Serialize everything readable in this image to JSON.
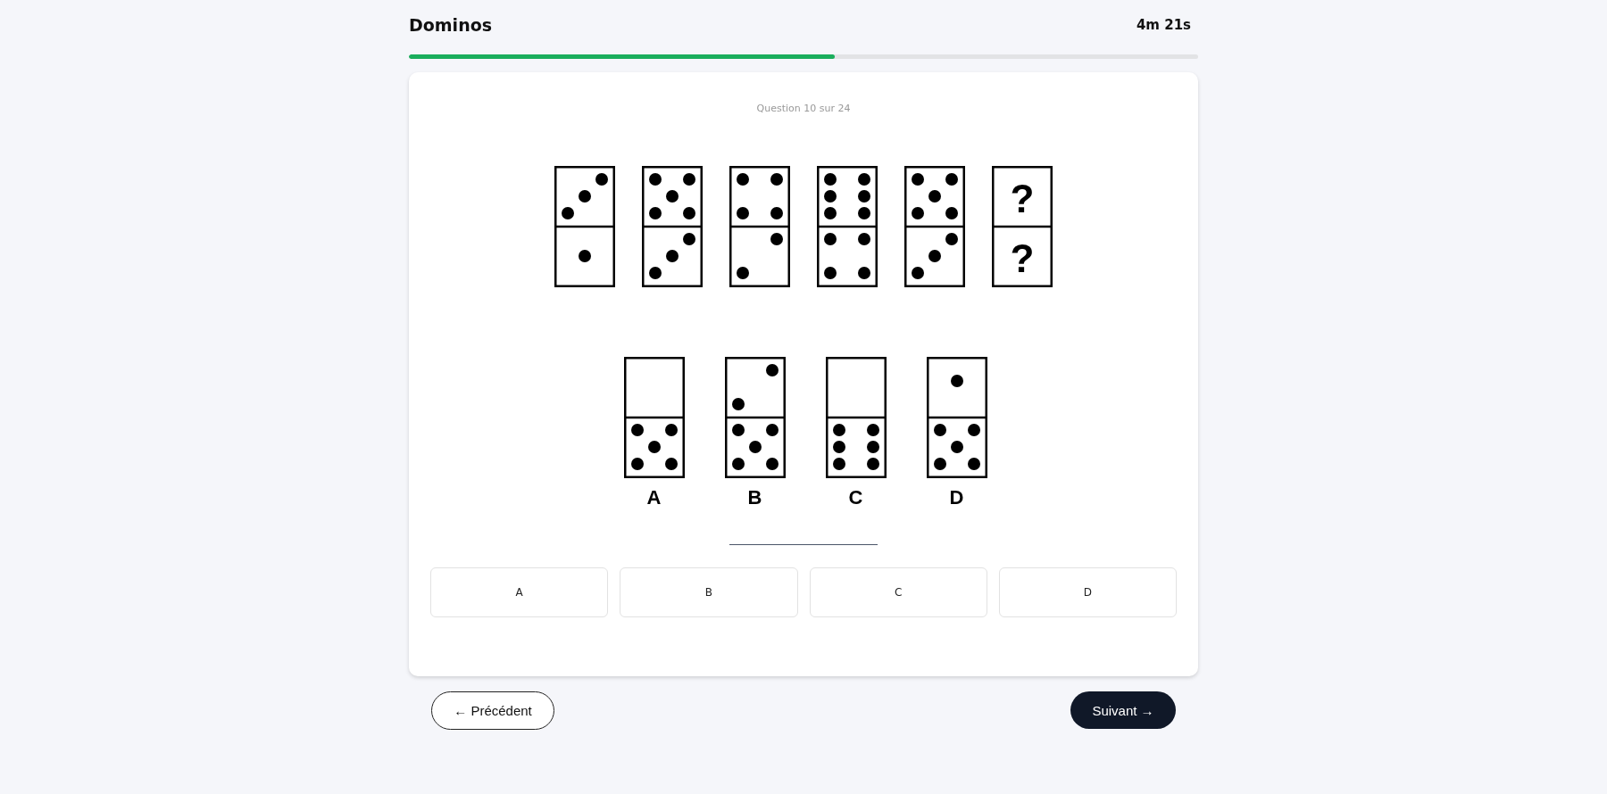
{
  "header": {
    "title": "Dominos",
    "timer": "4m 21s"
  },
  "progress": {
    "level": 0.54
  },
  "question": {
    "counter": "Question 10 sur 24",
    "sequence": [
      {
        "top": {
          "kind": "three"
        },
        "bottom": {
          "kind": "one"
        }
      },
      {
        "top": {
          "kind": "five"
        },
        "bottom": {
          "kind": "three"
        }
      },
      {
        "top": {
          "kind": "four"
        },
        "bottom": {
          "kind": "two"
        }
      },
      {
        "top": {
          "kind": "six"
        },
        "bottom": {
          "kind": "four"
        }
      },
      {
        "top": {
          "kind": "five"
        },
        "bottom": {
          "kind": "three"
        }
      },
      {
        "top": {
          "kind": "question",
          "text": "?"
        },
        "bottom": {
          "kind": "question",
          "text": "?"
        }
      }
    ],
    "choices": [
      {
        "label": "A",
        "top": {
          "kind": "blank"
        },
        "bottom": {
          "kind": "five"
        }
      },
      {
        "label": "B",
        "top": {
          "kind": "two"
        },
        "bottom": {
          "kind": "five"
        }
      },
      {
        "label": "C",
        "top": {
          "kind": "blank"
        },
        "bottom": {
          "kind": "six"
        }
      },
      {
        "label": "D",
        "top": {
          "kind": "one-high"
        },
        "bottom": {
          "kind": "five"
        }
      }
    ]
  },
  "options": [
    {
      "label": "A",
      "selected": false
    },
    {
      "label": "B",
      "selected": false
    },
    {
      "label": "C",
      "selected": false
    },
    {
      "label": "D",
      "selected": false
    }
  ],
  "nav": {
    "previous": "← Précédent",
    "next": "Suivant →"
  }
}
